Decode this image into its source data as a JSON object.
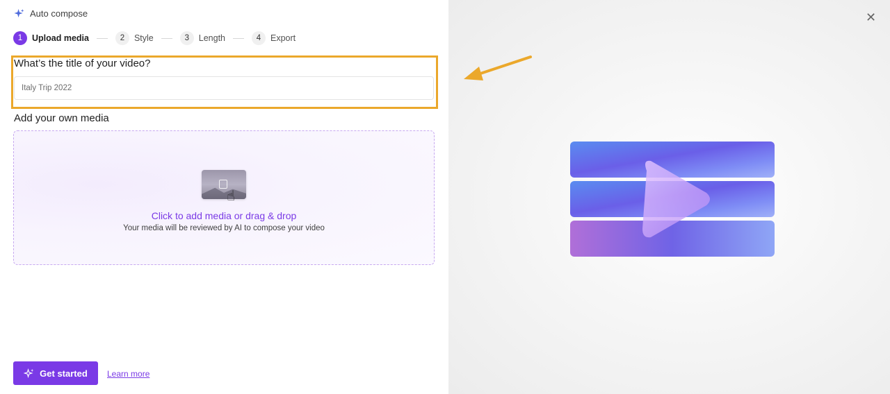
{
  "header": {
    "title": "Auto compose",
    "icon": "sparkle-icon"
  },
  "stepper": [
    {
      "num": "1",
      "label": "Upload media",
      "active": true
    },
    {
      "num": "2",
      "label": "Style",
      "active": false
    },
    {
      "num": "3",
      "label": "Length",
      "active": false
    },
    {
      "num": "4",
      "label": "Export",
      "active": false
    }
  ],
  "video_title": {
    "question": "What’s the title of your video?",
    "value": "Italy Trip 2022"
  },
  "media": {
    "heading": "Add your own media",
    "drop_main": "Click to add media or drag & drop",
    "drop_sub": "Your media will be reviewed by AI to compose your video"
  },
  "footer": {
    "start_label": "Get started",
    "learn_label": "Learn more"
  },
  "colors": {
    "accent": "#7a3ae6",
    "highlight": "#eba82b"
  },
  "icons": {
    "close": "close-icon",
    "arrow": "arrow-icon",
    "hero": "video-play-illustration"
  }
}
